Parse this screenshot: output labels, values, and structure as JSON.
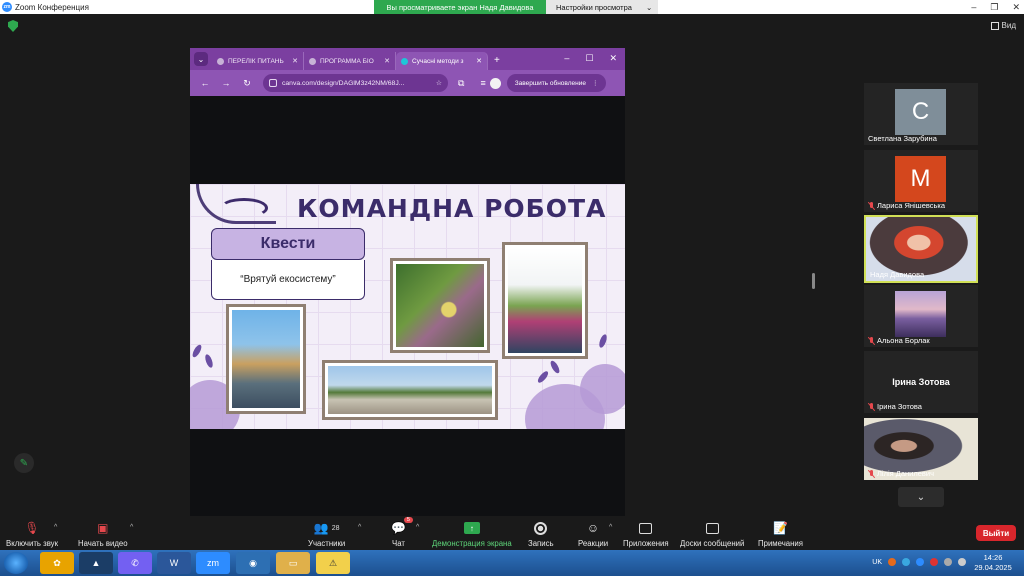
{
  "window": {
    "title": "Zoom Конференция",
    "logo_text": "zm",
    "share_banner": "Вы просматриваете экран Надя Давидова",
    "view_settings": "Настройки просмотра",
    "view_toggle": "Вид"
  },
  "browser": {
    "tabs": [
      {
        "label": "ПЕРЕЛІК ПИТАНЬ"
      },
      {
        "label": "ПРОГРАММА БІО"
      },
      {
        "label": "Сучасні методи з"
      }
    ],
    "url": "canva.com/design/DAGlM3z42NM/68J...",
    "update_button": "Завершить обновление"
  },
  "slide": {
    "title": "КОМАНДНА РОБОТА",
    "box_heading": "Квести",
    "box_text": "“Врятуй екосистему”",
    "accent": "#c7b3e3",
    "dark": "#3b2c6a"
  },
  "participants": [
    {
      "name": "Светлана Зарубина",
      "initial": "С",
      "color": "#7f8e99",
      "muted": false,
      "type": "initial"
    },
    {
      "name": "Лариса Янішевська",
      "initial": "М",
      "color": "#d4471d",
      "muted": true,
      "type": "initial"
    },
    {
      "name": "Надя Давидова",
      "muted": false,
      "type": "video",
      "active": true
    },
    {
      "name": "Альона Борлак",
      "muted": true,
      "type": "image"
    },
    {
      "name": "Ірина Зотова",
      "display": "Ірина Зотова",
      "muted": true,
      "type": "name"
    },
    {
      "name": "Лілія Данилевич",
      "muted": true,
      "type": "video"
    }
  ],
  "toolbar": {
    "mute": "Включить звук",
    "video": "Начать видео",
    "participants": "Участники",
    "participants_count": "28",
    "chat": "Чат",
    "chat_badge": "5",
    "share": "Демонстрация экрана",
    "record": "Запись",
    "reactions": "Реакции",
    "apps": "Приложения",
    "whiteboards": "Доски сообщений",
    "notes": "Примечания",
    "leave": "Выйти"
  },
  "taskbar": {
    "lang": "UK",
    "time": "14:26",
    "date": "29.04.2025"
  }
}
